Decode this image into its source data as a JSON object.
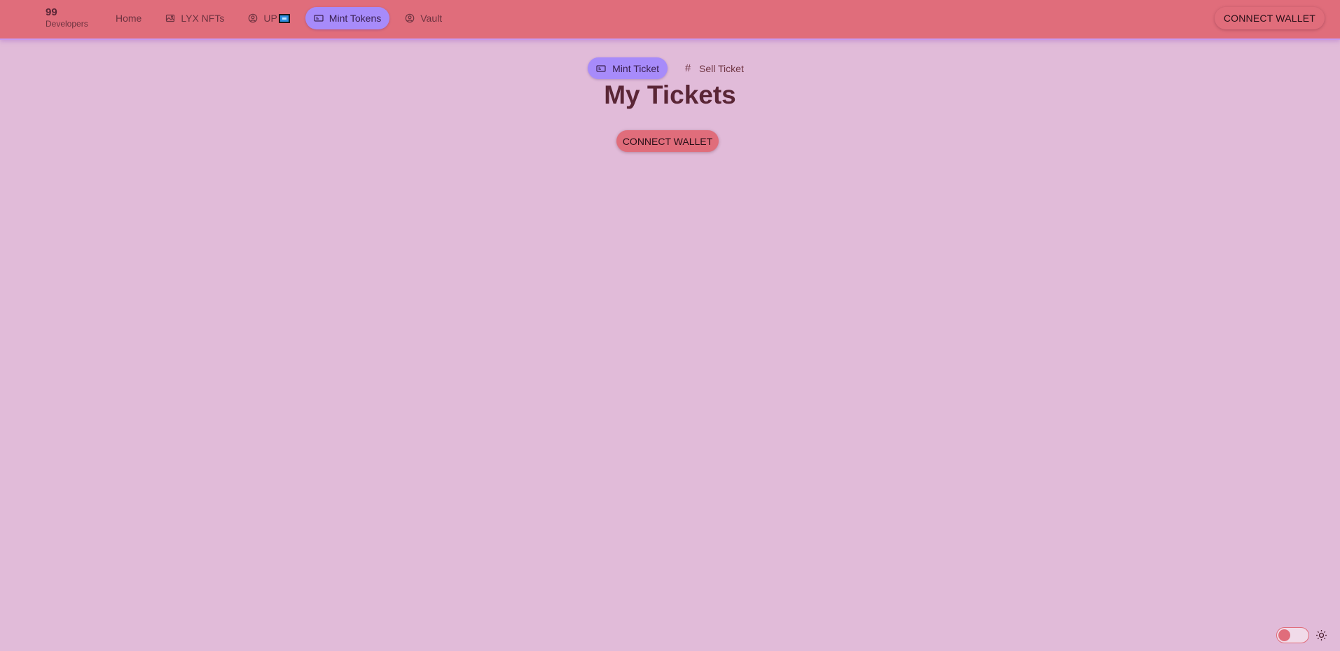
{
  "brand": {
    "number": "99",
    "subtitle": "Developers"
  },
  "nav": {
    "items": [
      {
        "label": "Home",
        "icon": "none"
      },
      {
        "label": "LYX NFTs",
        "icon": "image-icon"
      },
      {
        "label": "UP",
        "icon": "user-circle-icon",
        "badge": "blue-square-badge"
      },
      {
        "label": "Mint Tokens",
        "icon": "ticket-icon",
        "active": true
      },
      {
        "label": "Vault",
        "icon": "user-circle-icon"
      }
    ]
  },
  "header": {
    "connect_label": "CONNECT WALLET"
  },
  "tabs": [
    {
      "label": "Mint Ticket",
      "icon": "ticket-icon",
      "active": true
    },
    {
      "label": "Sell Ticket",
      "icon": "hash-icon"
    }
  ],
  "main": {
    "title": "My Tickets",
    "connect_label": "CONNECT WALLET"
  },
  "theme": {
    "mode": "light",
    "toggle_icon": "sun-icon"
  },
  "colors": {
    "background": "#e1bbd9",
    "topbar": "#e06d7b",
    "accent": "#a78bfa",
    "text": "#5a2636"
  }
}
